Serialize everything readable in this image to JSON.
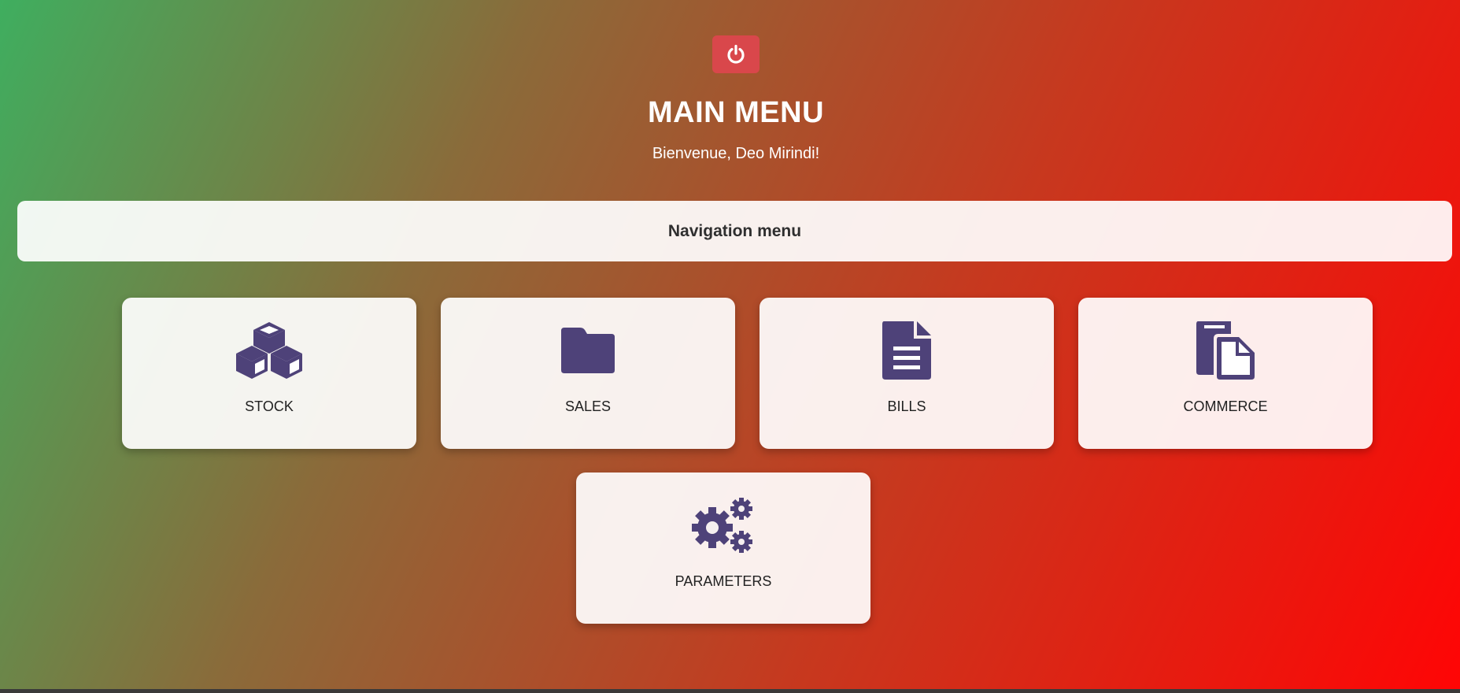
{
  "header": {
    "power_icon": "power-icon",
    "title": "MAIN MENU",
    "welcome": "Bienvenue, Deo Mirindi!"
  },
  "nav": {
    "label": "Navigation menu"
  },
  "cards": [
    {
      "label": "STOCK",
      "icon": "cubes-icon"
    },
    {
      "label": "SALES",
      "icon": "folder-icon"
    },
    {
      "label": "BILLS",
      "icon": "document-icon"
    },
    {
      "label": "COMMERCE",
      "icon": "copy-documents-icon"
    },
    {
      "label": "PARAMETERS",
      "icon": "gears-icon"
    }
  ],
  "colors": {
    "icon": "#4e4279",
    "power_button": "#d9474b",
    "gradient_start": "#3fae5f",
    "gradient_end": "#ff0505"
  }
}
